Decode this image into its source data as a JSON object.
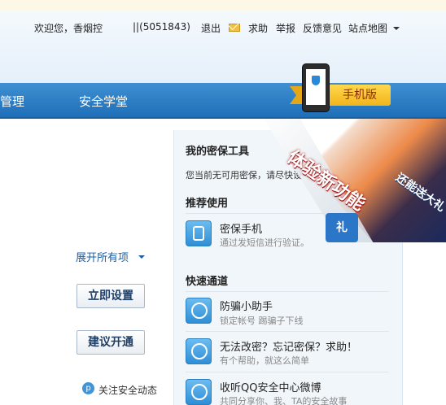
{
  "topbar": {
    "welcome": "欢迎您，香烟控",
    "account": "||(5051843)",
    "logout": "退出",
    "help": "求助",
    "report": "举报",
    "feedback": "反馈意见",
    "sitemap": "站点地图"
  },
  "nav": {
    "items": [
      "管理",
      "安全学堂"
    ],
    "mobile_badge": "手机版"
  },
  "left": {
    "expand_all": "展开所有项",
    "setup_button": "立即设置",
    "enable_button": "建议开通",
    "follow": "关注安全动态"
  },
  "right": {
    "my_tools_title": "我的密保工具",
    "no_tools_text": "您当前无可用密保，请尽快设",
    "recommended_title": "推荐使用",
    "recommended": [
      {
        "title": "密保手机",
        "desc": "通过发短信进行验证。",
        "icon": "phone-icon"
      }
    ],
    "quick_title": "快速通道",
    "quick": [
      {
        "title": "防骗小助手",
        "desc": "锁定帐号 踢骗子下线",
        "icon": "lock-user-icon"
      },
      {
        "title": "无法改密？忘记密保？求助！",
        "desc": "有个帮助，就这么简单",
        "icon": "bulb-icon"
      },
      {
        "title": "收听QQ安全中心微博",
        "desc": "共同分享你、我、TA的安全故事",
        "icon": "weibo-icon"
      }
    ]
  },
  "promo": {
    "headline": "体验新功能",
    "sub": "还能送大礼",
    "gift": "礼"
  },
  "colors": {
    "nav_blue": "#2a7cc5",
    "link_blue": "#1a5da5",
    "ribbon_yellow": "#f2b41d"
  }
}
